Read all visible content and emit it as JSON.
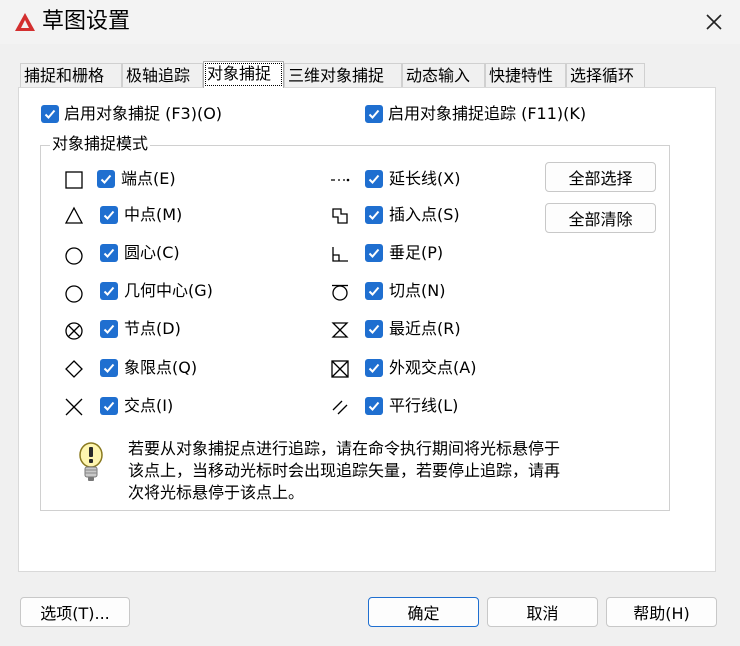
{
  "window": {
    "title": "草图设置"
  },
  "tabs": [
    {
      "label": "捕捉和栅格"
    },
    {
      "label": "极轴追踪"
    },
    {
      "label": "对象捕捉"
    },
    {
      "label": "三维对象捕捉"
    },
    {
      "label": "动态输入"
    },
    {
      "label": "快捷特性"
    },
    {
      "label": "选择循环"
    }
  ],
  "top_options": {
    "enable_osnap": {
      "label": "启用对象捕捉 (F3)(O)",
      "checked": true
    },
    "enable_tracking": {
      "label": "启用对象捕捉追踪 (F11)(K)",
      "checked": true
    }
  },
  "modes": {
    "group_title": "对象捕捉模式",
    "left": [
      {
        "label": "端点(E)",
        "checked": true
      },
      {
        "label": "中点(M)",
        "checked": true
      },
      {
        "label": "圆心(C)",
        "checked": true
      },
      {
        "label": "几何中心(G)",
        "checked": true
      },
      {
        "label": "节点(D)",
        "checked": true
      },
      {
        "label": "象限点(Q)",
        "checked": true
      },
      {
        "label": "交点(I)",
        "checked": true
      }
    ],
    "right": [
      {
        "label": "延长线(X)",
        "checked": true
      },
      {
        "label": "插入点(S)",
        "checked": true
      },
      {
        "label": "垂足(P)",
        "checked": true
      },
      {
        "label": "切点(N)",
        "checked": true
      },
      {
        "label": "最近点(R)",
        "checked": true
      },
      {
        "label": "外观交点(A)",
        "checked": true
      },
      {
        "label": "平行线(L)",
        "checked": true
      }
    ],
    "select_all": "全部选择",
    "clear_all": "全部清除"
  },
  "tip": {
    "lines": [
      "若要从对象捕捉点进行追踪，请在命令执行期间将光标悬停于",
      "该点上，当移动光标时会出现追踪矢量，若要停止追踪，请再",
      "次将光标悬停于该点上。"
    ]
  },
  "footer": {
    "options": "选项(T)...",
    "ok": "确定",
    "cancel": "取消",
    "help": "帮助(H)"
  },
  "colors": {
    "accent": "#1f6fd0",
    "app_icon": "#d32f2f"
  }
}
